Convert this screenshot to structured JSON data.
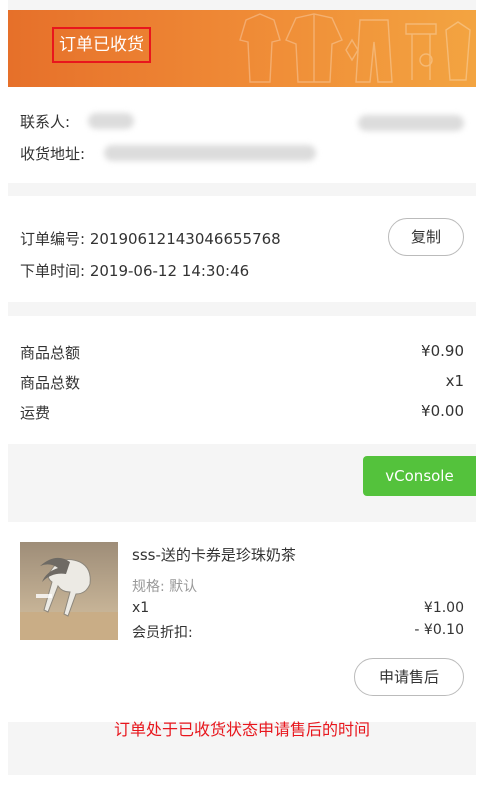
{
  "header": {
    "status": "订单已收货"
  },
  "contact": {
    "name_label": "联系人:",
    "address_label": "收货地址:"
  },
  "order": {
    "number_label": "订单编号:",
    "number": "20190612143046655768",
    "time_label": "下单时间:",
    "time": "2019-06-12 14:30:46",
    "copy_label": "复制"
  },
  "summary": {
    "total_label": "商品总额",
    "total": "¥0.90",
    "count_label": "商品总数",
    "count": "x1",
    "shipping_label": "运费",
    "shipping": "¥0.00"
  },
  "vconsole": {
    "label": "vConsole"
  },
  "product": {
    "title": "sss-送的卡券是珍珠奶茶",
    "spec": "规格: 默认",
    "qty": "x1",
    "price": "¥1.00",
    "discount_label": "会员折扣:",
    "discount": "- ¥0.10",
    "after_sale_label": "申请售后"
  },
  "annotation": {
    "text": "订单处于已收货状态申请售后的时间"
  },
  "colors": {
    "banner_start": "#e6702a",
    "banner_end": "#f3a441",
    "accent_red": "#e8161d",
    "vconsole_green": "#54c23c"
  }
}
